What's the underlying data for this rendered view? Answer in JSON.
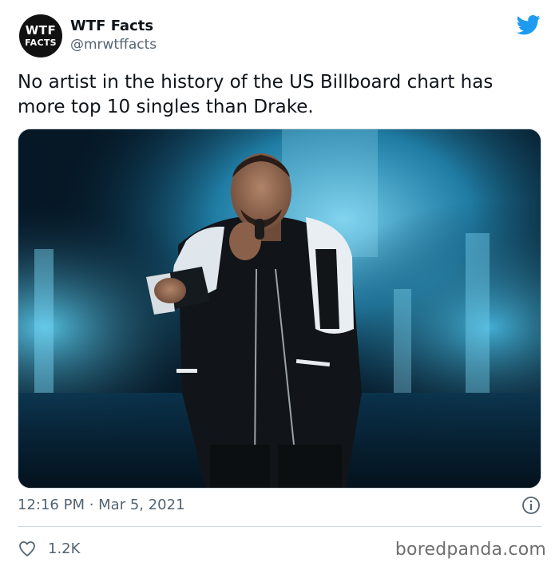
{
  "author": {
    "avatar_line1": "WTF",
    "avatar_line2": "FACTS",
    "name": "WTF Facts",
    "handle": "@mrwtffacts"
  },
  "tweet": {
    "text": "No artist in the history of the US Billboard chart has more top 10 singles than Drake.",
    "timestamp": "12:16 PM · Mar 5, 2021",
    "likes": "1.2K"
  },
  "photo": {
    "subject": "performer-on-stage"
  },
  "icons": {
    "brand": "twitter-bird-icon",
    "info": "info-icon",
    "like": "heart-icon"
  },
  "colors": {
    "twitter_blue": "#1d9bf0",
    "secondary_text": "#536471",
    "stage_light": "#2bb6e8"
  },
  "watermark": "boredpanda.com"
}
